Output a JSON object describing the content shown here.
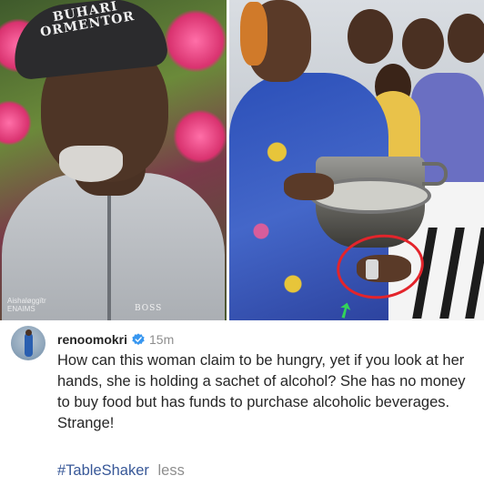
{
  "images": {
    "left_photo": {
      "cap_text_line1": "BUHARI",
      "cap_text_line2": "ORMENTOR",
      "jacket_brand": "BOSS",
      "watermark_line1": "Aishaløggïtr",
      "watermark_line2": "ENAIMS"
    },
    "right_photo": {
      "annotation_circle_color": "#e3242b",
      "annotation_arrow_color": "#32d35a"
    }
  },
  "post": {
    "username": "renoomokri",
    "verified_icon": "verified-badge-icon",
    "verified_color": "#3897f0",
    "timestamp": "15m",
    "caption": "How can this woman claim to be hungry, yet if you look at her hands, she is holding a sachet of alcohol? She has no money to buy food but has funds to purchase alcoholic beverages. Strange!",
    "hashtag": "#TableShaker",
    "less_label": "less",
    "hashtag_color": "#385898"
  }
}
